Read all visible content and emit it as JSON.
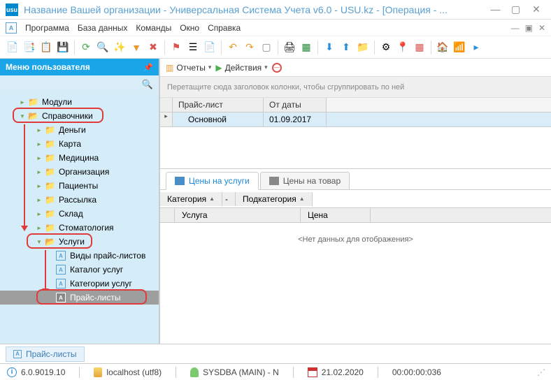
{
  "window": {
    "title": "Название Вашей организации - Универсальная Система Учета v6.0 - USU.kz - [Операция - ...",
    "logo_text": "usu"
  },
  "menu": {
    "program": "Программа",
    "database": "База данных",
    "commands": "Команды",
    "window": "Окно",
    "help": "Справка"
  },
  "sidebar": {
    "header": "Меню пользователя",
    "items": {
      "modules": "Модули",
      "references": "Справочники",
      "money": "Деньги",
      "map": "Карта",
      "medicine": "Медицина",
      "organization": "Организация",
      "patients": "Пациенты",
      "mailing": "Рассылка",
      "warehouse": "Склад",
      "dentistry": "Стоматология",
      "services": "Услуги",
      "pricelist_types": "Виды прайс-листов",
      "service_catalog": "Каталог услуг",
      "service_categories": "Категории услуг",
      "pricelists": "Прайс-листы"
    }
  },
  "content_toolbar": {
    "reports": "Отчеты",
    "actions": "Действия"
  },
  "grid": {
    "grouphint": "Перетащите сюда заголовок колонки, чтобы сгруппировать по ней",
    "col_pricelist": "Прайс-лист",
    "col_date": "От даты",
    "row1_name": "Основной",
    "row1_date": "01.09.2017"
  },
  "tabs": {
    "services_prices": "Цены на услуги",
    "goods_prices": "Цены на товар"
  },
  "group": {
    "category": "Категория",
    "subcategory": "Подкатегория"
  },
  "subgrid": {
    "col_service": "Услуга",
    "col_price": "Цена",
    "nodata": "<Нет данных для отображения>"
  },
  "bottom_tab": "Прайс-листы",
  "status": {
    "version": "6.0.9019.10",
    "host": "localhost (utf8)",
    "user": "SYSDBA (MAIN) - N",
    "date": "21.02.2020",
    "time": "00:00:00:036"
  }
}
